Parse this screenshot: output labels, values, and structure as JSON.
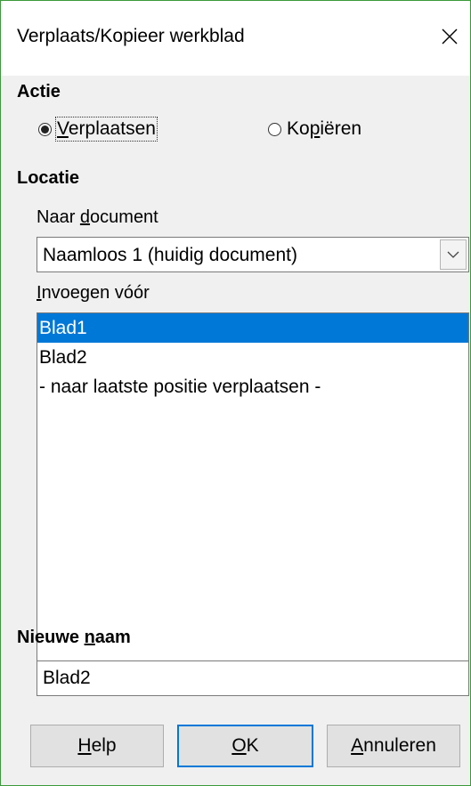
{
  "window": {
    "title": "Verplaats/Kopieer werkblad",
    "close_glyph": "×"
  },
  "action": {
    "heading": "Actie",
    "move": {
      "label_pre": "",
      "label_ul": "V",
      "label_post": "erplaatsen",
      "checked": true
    },
    "copy": {
      "label_pre": "Ko",
      "label_ul": "p",
      "label_post": "iëren",
      "checked": false
    }
  },
  "location": {
    "heading": "Locatie",
    "to_document": {
      "label_pre": "Naar ",
      "label_ul": "d",
      "label_post": "ocument"
    },
    "document_value": "Naamloos 1 (huidig document)",
    "insert_before": {
      "label_pre": "",
      "label_ul": "I",
      "label_post": "nvoegen vóór"
    },
    "items": [
      {
        "label": "Blad1",
        "selected": true
      },
      {
        "label": "Blad2",
        "selected": false
      },
      {
        "label": "- naar laatste positie verplaatsen -",
        "selected": false
      }
    ]
  },
  "new_name": {
    "heading_pre": "Nieuwe ",
    "heading_ul": "n",
    "heading_post": "aam",
    "value": "Blad2"
  },
  "buttons": {
    "help": {
      "label_pre": "",
      "label_ul": "H",
      "label_post": "elp"
    },
    "ok": {
      "label_pre": "",
      "label_ul": "O",
      "label_post": "K"
    },
    "cancel": {
      "label_pre": "",
      "label_ul": "A",
      "label_post": "nnuleren"
    }
  },
  "colors": {
    "selection": "#0078d7",
    "window_border": "#3a9a3a",
    "dialog_bg": "#f0f0f0"
  }
}
